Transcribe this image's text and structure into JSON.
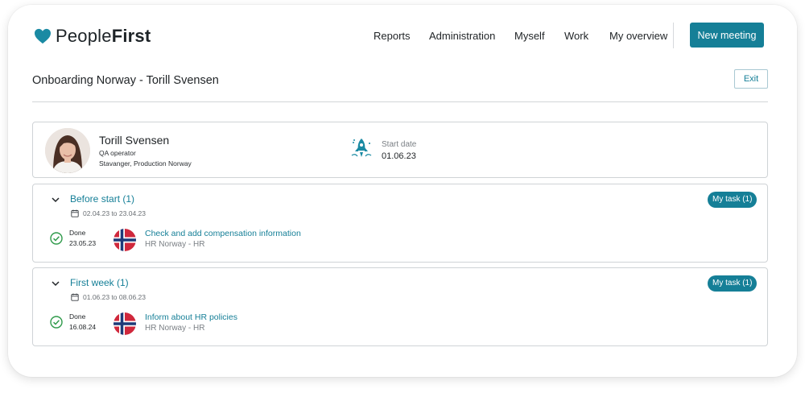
{
  "brand": {
    "name_regular": "People",
    "name_bold": "First",
    "accent": "#157f97",
    "logo_icon": "heart-icon"
  },
  "nav": {
    "items": [
      "Reports",
      "Administration",
      "Myself",
      "Work",
      "My overview"
    ],
    "new_meeting_label": "New meeting"
  },
  "page": {
    "title": "Onboarding Norway - Torill Svensen",
    "exit_label": "Exit"
  },
  "profile": {
    "name": "Torill Svensen",
    "role": "QA operator",
    "location": "Stavanger, Production Norway",
    "start_label": "Start date",
    "start_value": "01.06.23",
    "start_icon": "rocket-icon"
  },
  "phases": [
    {
      "title": "Before start (1)",
      "dates": "02.04.23 to 23.04.23",
      "badge": "My task (1)",
      "task": {
        "status": "Done",
        "status_date": "23.05.23",
        "title": "Check and add compensation information",
        "subtitle": "HR Norway - HR",
        "flag": "norway-flag-icon"
      }
    },
    {
      "title": "First week (1)",
      "dates": "01.06.23 to 08.06.23",
      "badge": "My task (1)",
      "task": {
        "status": "Done",
        "status_date": "16.08.24",
        "title": "Inform about HR policies",
        "subtitle": "HR Norway - HR",
        "flag": "norway-flag-icon"
      }
    }
  ]
}
